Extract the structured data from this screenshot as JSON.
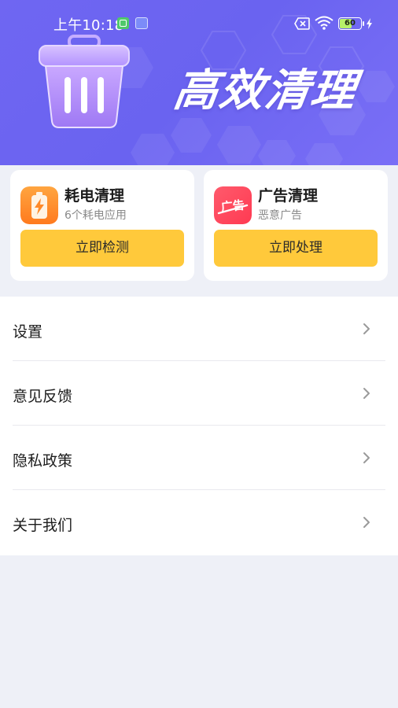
{
  "status_bar": {
    "time": "上午10:18",
    "battery_level": "60",
    "icons": [
      "app-notification-icon",
      "mail-icon",
      "no-sim-icon",
      "wifi-icon",
      "battery-icon",
      "charging-icon"
    ]
  },
  "banner": {
    "title": "高效清理",
    "icon": "trash-can-icon"
  },
  "cards": [
    {
      "title": "耗电清理",
      "subtitle": "6个耗电应用",
      "button_label": "立即检测",
      "icon": "battery-charge-icon",
      "icon_color": "#ff8a2a"
    },
    {
      "title": "广告清理",
      "subtitle": "恶意广告",
      "button_label": "立即处理",
      "icon": "ad-block-icon",
      "icon_text": "广告",
      "icon_color": "#ff4d5e"
    }
  ],
  "menu": {
    "items": [
      {
        "label": "设置"
      },
      {
        "label": "意见反馈"
      },
      {
        "label": "隐私政策"
      },
      {
        "label": "关于我们"
      }
    ]
  },
  "colors": {
    "banner": "#6c64f1",
    "button": "#ffc93b",
    "background": "#eef0f7"
  }
}
